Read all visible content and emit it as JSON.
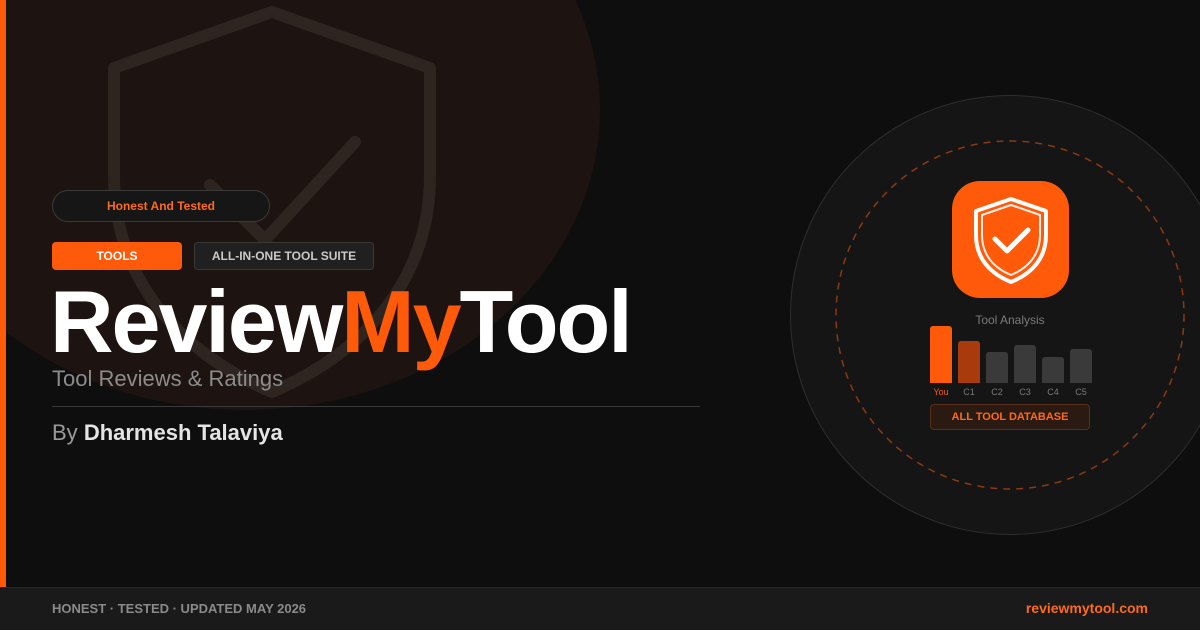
{
  "badge": {
    "label": "Honest And Tested"
  },
  "tags": {
    "primary": "TOOLS",
    "secondary": "ALL-IN-ONE TOOL SUITE"
  },
  "title": {
    "part1": "Review",
    "part2": "My",
    "part3": "Tool"
  },
  "subtitle": "Tool Reviews & Ratings",
  "byline": {
    "prefix": "By",
    "author": "Dharmesh Talaviya"
  },
  "panel": {
    "analysis_label": "Tool Analysis",
    "bars": [
      {
        "label": "You",
        "value": 1.0,
        "color": "#ff5a0a"
      },
      {
        "label": "C1",
        "value": 0.73,
        "color": "#a83a0c"
      },
      {
        "label": "C2",
        "value": 0.55,
        "color": "#3a3a3a"
      },
      {
        "label": "C3",
        "value": 0.67,
        "color": "#3a3a3a"
      },
      {
        "label": "C4",
        "value": 0.45,
        "color": "#3a3a3a"
      },
      {
        "label": "C5",
        "value": 0.6,
        "color": "#3a3a3a"
      }
    ],
    "button_label": "ALL TOOL DATABASE"
  },
  "footer": {
    "left": "HONEST · TESTED · UPDATED MAY 2026",
    "right": "reviewmytool.com"
  },
  "colors": {
    "accent": "#ff5a0a",
    "background": "#0e0e0e",
    "text": "#ffffff"
  },
  "icons": {
    "main": "shield-check-icon",
    "background": "shield-check-icon"
  }
}
